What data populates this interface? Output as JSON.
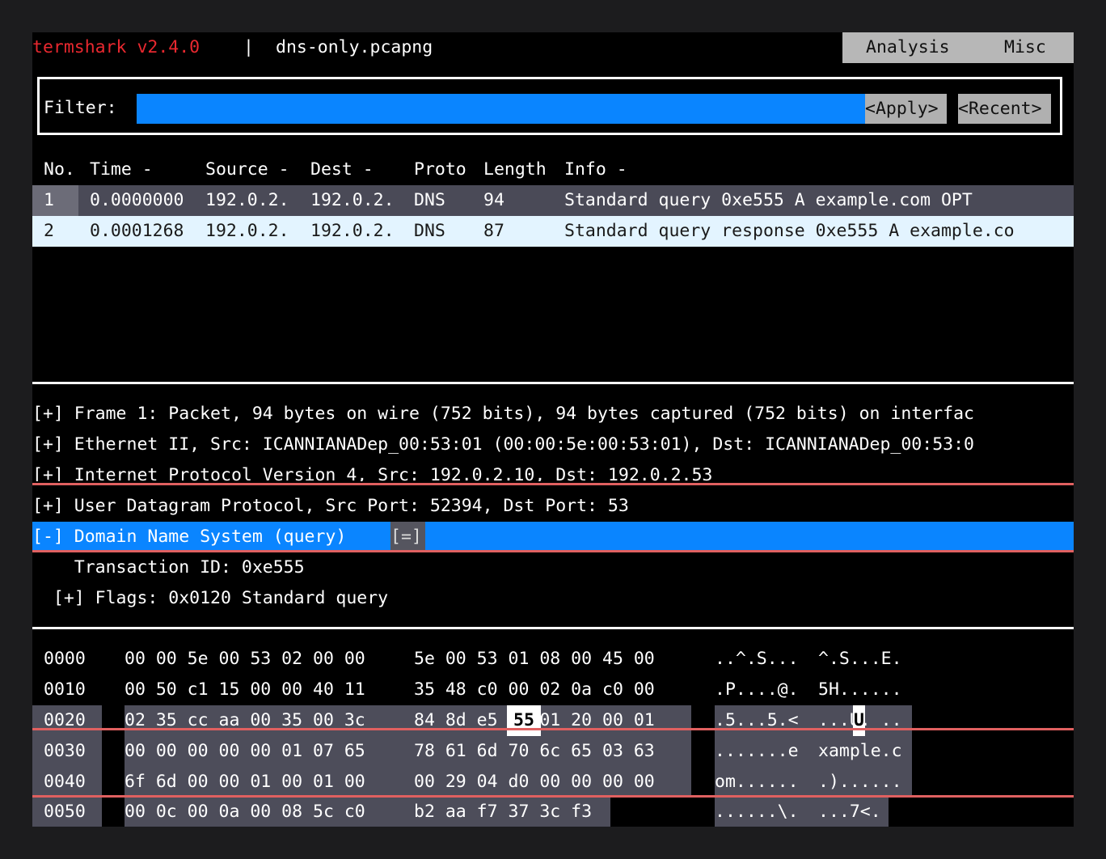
{
  "title": {
    "app": "termshark v2.4.0",
    "separator": "|",
    "file": "dns-only.pcapng"
  },
  "menu": {
    "analysis": "Analysis",
    "misc": "Misc"
  },
  "filter": {
    "label": "Filter:",
    "value": "",
    "apply": "<Apply>",
    "recent": "<Recent>"
  },
  "packet_list": {
    "headers": {
      "no": "No.",
      "time": "Time -",
      "source": "Source -",
      "dest": "Dest -",
      "proto": "Proto",
      "length": "Length",
      "info": "Info -"
    },
    "rows": [
      {
        "no": "1",
        "time": "0.0000000",
        "source": "192.0.2.",
        "dest": "192.0.2.",
        "proto": "DNS",
        "length": "94",
        "info": "Standard query 0xe555 A example.com OPT"
      },
      {
        "no": "2",
        "time": "0.0001268",
        "source": "192.0.2.",
        "dest": "192.0.2.",
        "proto": "DNS",
        "length": "87",
        "info": "Standard query response 0xe555 A example.co"
      }
    ]
  },
  "details": {
    "lines": [
      "[+] Frame 1: Packet, 94 bytes on wire (752 bits), 94 bytes captured (752 bits) on interfac",
      "[+] Ethernet II, Src: ICANNIANADep_00:53:01 (00:00:5e:00:53:01), Dst: ICANNIANADep_00:53:0",
      "[+] Internet Protocol Version 4, Src: 192.0.2.10, Dst: 192.0.2.53",
      "[+] User Datagram Protocol, Src Port: 52394, Dst Port: 53",
      "[-] Domain Name System (query)",
      "    Transaction ID: 0xe555",
      "  [+] Flags: 0x0120 Standard query"
    ],
    "expand_badge": "[=]"
  },
  "hex": {
    "rows": [
      {
        "offset": "0000",
        "hex1": "00 00 5e 00 53 02 00 00",
        "hex2": "5e 00 53 01 08 00 45 00",
        "ascii1": "..^.S...",
        "ascii2": "^.S...E."
      },
      {
        "offset": "0010",
        "hex1": "00 50 c1 15 00 00 40 11",
        "hex2": "35 48 c0 00 02 0a c0 00",
        "ascii1": ".P....@.",
        "ascii2": "5H......"
      },
      {
        "offset": "0020",
        "hex1": "02 35 cc aa 00 35 00 3c",
        "hex2": "84 8d e5 55 01 20 00 01",
        "ascii1": ".5...5.<",
        "ascii2": "...U. .."
      },
      {
        "offset": "0030",
        "hex1": "00 00 00 00 00 01 07 65",
        "hex2": "78 61 6d 70 6c 65 03 63",
        "ascii1": ".......e",
        "ascii2": "xample.c"
      },
      {
        "offset": "0040",
        "hex1": "6f 6d 00 00 01 00 01 00",
        "hex2": "00 29 04 d0 00 00 00 00",
        "ascii1": "om......",
        "ascii2": ".)......"
      },
      {
        "offset": "0050",
        "hex1": "00 0c 00 0a 00 08 5c c0",
        "hex2": "b2 aa f7 37 3c f3",
        "ascii1": "......\\.",
        "ascii2": "...7<."
      }
    ],
    "cursor_byte": "55",
    "cursor_char": "U"
  }
}
